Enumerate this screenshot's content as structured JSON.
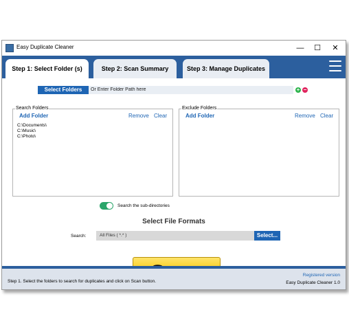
{
  "window": {
    "title": "Easy Duplicate Cleaner",
    "controls": {
      "minimize": "—",
      "maximize": "☐",
      "close": "✕"
    }
  },
  "tabs": [
    {
      "label": "Step 1: Select Folder (s)",
      "active": true
    },
    {
      "label": "Step 2: Scan Summary",
      "active": false
    },
    {
      "label": "Step 3: Manage Duplicates",
      "active": false
    }
  ],
  "folder_bar": {
    "select_button": "Select Folders",
    "path_placeholder": "Or Enter Folder Path here",
    "add_symbol": "+",
    "remove_symbol": "−"
  },
  "search_folders": {
    "label": "Search Folders",
    "add": "Add Folder",
    "remove": "Remove",
    "clear": "Clear",
    "items": [
      "C:\\Documents\\",
      "C:\\Music\\",
      "C:\\Photo\\"
    ]
  },
  "exclude_folders": {
    "label": "Exclude Folders",
    "add": "Add Folder",
    "remove": "Remove",
    "clear": "Clear"
  },
  "subdirectories": {
    "label": "Search the sub-directories",
    "on": true
  },
  "file_formats": {
    "title": "Select File Formats",
    "search_label": "Search:",
    "value": "All Files ( *.* )",
    "select_button": "Select..."
  },
  "scan_button": "Scan",
  "status": {
    "message": "Step 1. Select the folders to search for duplicates and click on Scan button.",
    "registered": "Registered version",
    "version": "Easy Duplicate Cleaner 1.0"
  },
  "colors": {
    "accent": "#2c5f9e",
    "button_blue": "#1e65b4",
    "toggle_green": "#2aa56a",
    "scan_yellow": "#f6c400",
    "add_green": "#2ab34a",
    "remove_pink": "#e0245e"
  },
  "icons": {
    "app": "app-icon",
    "menu": "hamburger-menu-icon"
  }
}
